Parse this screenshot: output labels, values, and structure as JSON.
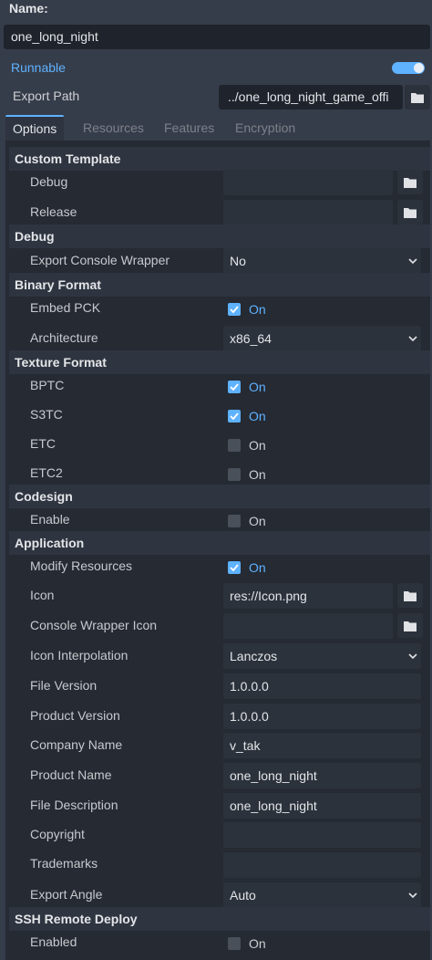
{
  "header": {
    "name_label": "Name:",
    "name_value": "one_long_night",
    "runnable_label": "Runnable",
    "runnable_on": true,
    "export_path_label": "Export Path",
    "export_path_value": "../one_long_night_game_offi"
  },
  "tabs": [
    "Options",
    "Resources",
    "Features",
    "Encryption"
  ],
  "active_tab": "Options",
  "sections": {
    "custom_template": "Custom Template",
    "debug": "Debug",
    "binary_format": "Binary Format",
    "texture_format": "Texture Format",
    "codesign": "Codesign",
    "application": "Application",
    "ssh": "SSH Remote Deploy"
  },
  "props": {
    "debug_template": {
      "label": "Debug",
      "value": ""
    },
    "release_template": {
      "label": "Release",
      "value": ""
    },
    "console_wrapper": {
      "label": "Export Console Wrapper",
      "value": "No"
    },
    "embed_pck": {
      "label": "Embed PCK",
      "value": "On"
    },
    "architecture": {
      "label": "Architecture",
      "value": "x86_64"
    },
    "bptc": {
      "label": "BPTC",
      "value": "On"
    },
    "s3tc": {
      "label": "S3TC",
      "value": "On"
    },
    "etc": {
      "label": "ETC",
      "value": "On"
    },
    "etc2": {
      "label": "ETC2",
      "value": "On"
    },
    "codesign_enable": {
      "label": "Enable",
      "value": "On"
    },
    "modify_resources": {
      "label": "Modify Resources",
      "value": "On"
    },
    "icon": {
      "label": "Icon",
      "value": "res://Icon.png"
    },
    "console_icon": {
      "label": "Console Wrapper Icon",
      "value": ""
    },
    "icon_interp": {
      "label": "Icon Interpolation",
      "value": "Lanczos"
    },
    "file_version": {
      "label": "File Version",
      "value": "1.0.0.0"
    },
    "product_version": {
      "label": "Product Version",
      "value": "1.0.0.0"
    },
    "company_name": {
      "label": "Company Name",
      "value": "v_tak"
    },
    "product_name": {
      "label": "Product Name",
      "value": "one_long_night"
    },
    "file_description": {
      "label": "File Description",
      "value": "one_long_night"
    },
    "copyright": {
      "label": "Copyright",
      "value": ""
    },
    "trademarks": {
      "label": "Trademarks",
      "value": ""
    },
    "export_angle": {
      "label": "Export Angle",
      "value": "Auto"
    },
    "ssh_enabled": {
      "label": "Enabled",
      "value": "On"
    }
  },
  "checked": {
    "embed_pck": true,
    "bptc": true,
    "s3tc": true,
    "etc": false,
    "etc2": false,
    "codesign_enable": false,
    "modify_resources": true,
    "ssh_enabled": false
  },
  "colors": {
    "accent": "#5fb2ff",
    "background": "#363d4a",
    "panel": "#252a33"
  }
}
